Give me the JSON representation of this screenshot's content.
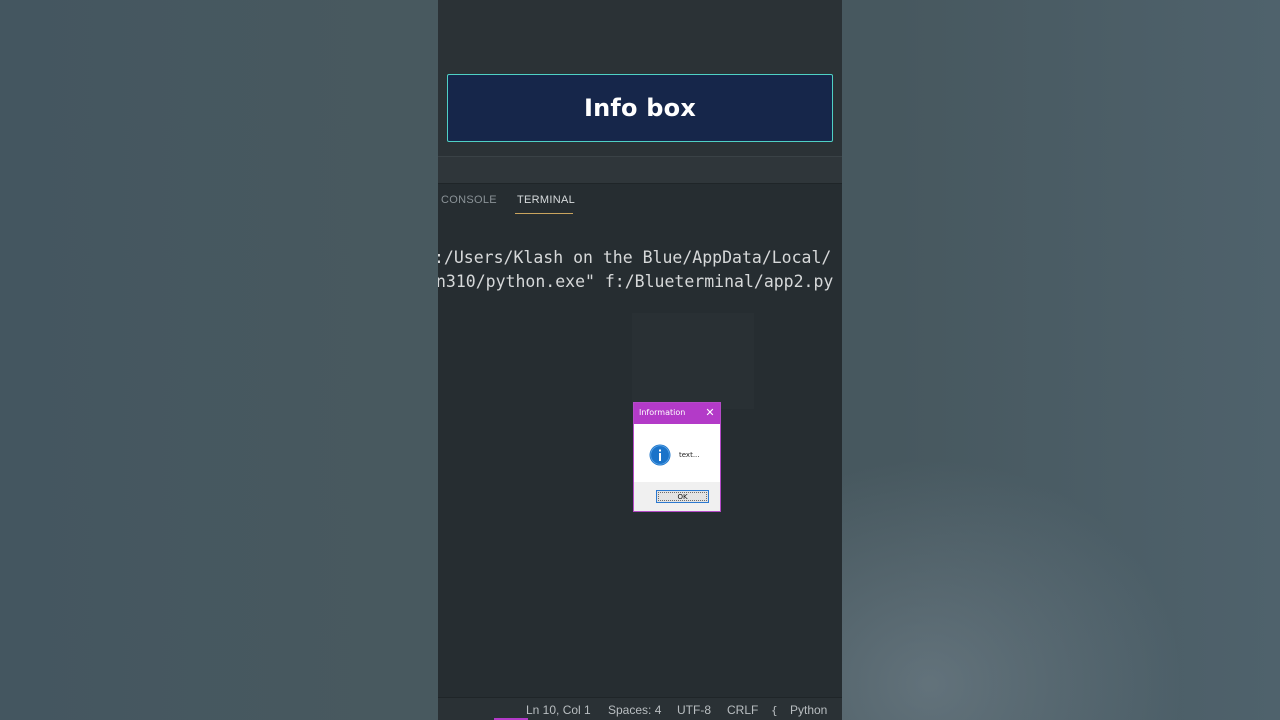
{
  "header": {
    "title": "Info box"
  },
  "panel": {
    "tabs": [
      {
        "label": "CONSOLE",
        "active": false
      },
      {
        "label": "TERMINAL",
        "active": true
      }
    ]
  },
  "terminal": {
    "lines": [
      ":/Users/Klash on the Blue/AppData/Local/",
      "n310/python.exe\" f:/Blueterminal/app2.py"
    ]
  },
  "dialog": {
    "title": "Information",
    "message": "text...",
    "ok_label": "OK",
    "icon": "info-icon",
    "colors": {
      "titlebar": "#b33ac8",
      "icon": "#1a73c9"
    }
  },
  "status_bar": {
    "position": "Ln 10, Col 1",
    "indent": "Spaces: 4",
    "encoding": "UTF-8",
    "eol": "CRLF",
    "brace_icon": "{",
    "language": "Python"
  },
  "colors": {
    "title_box_bg": "#16264a",
    "title_box_border": "#4fd1c5",
    "editor_bg": "#262d31"
  }
}
